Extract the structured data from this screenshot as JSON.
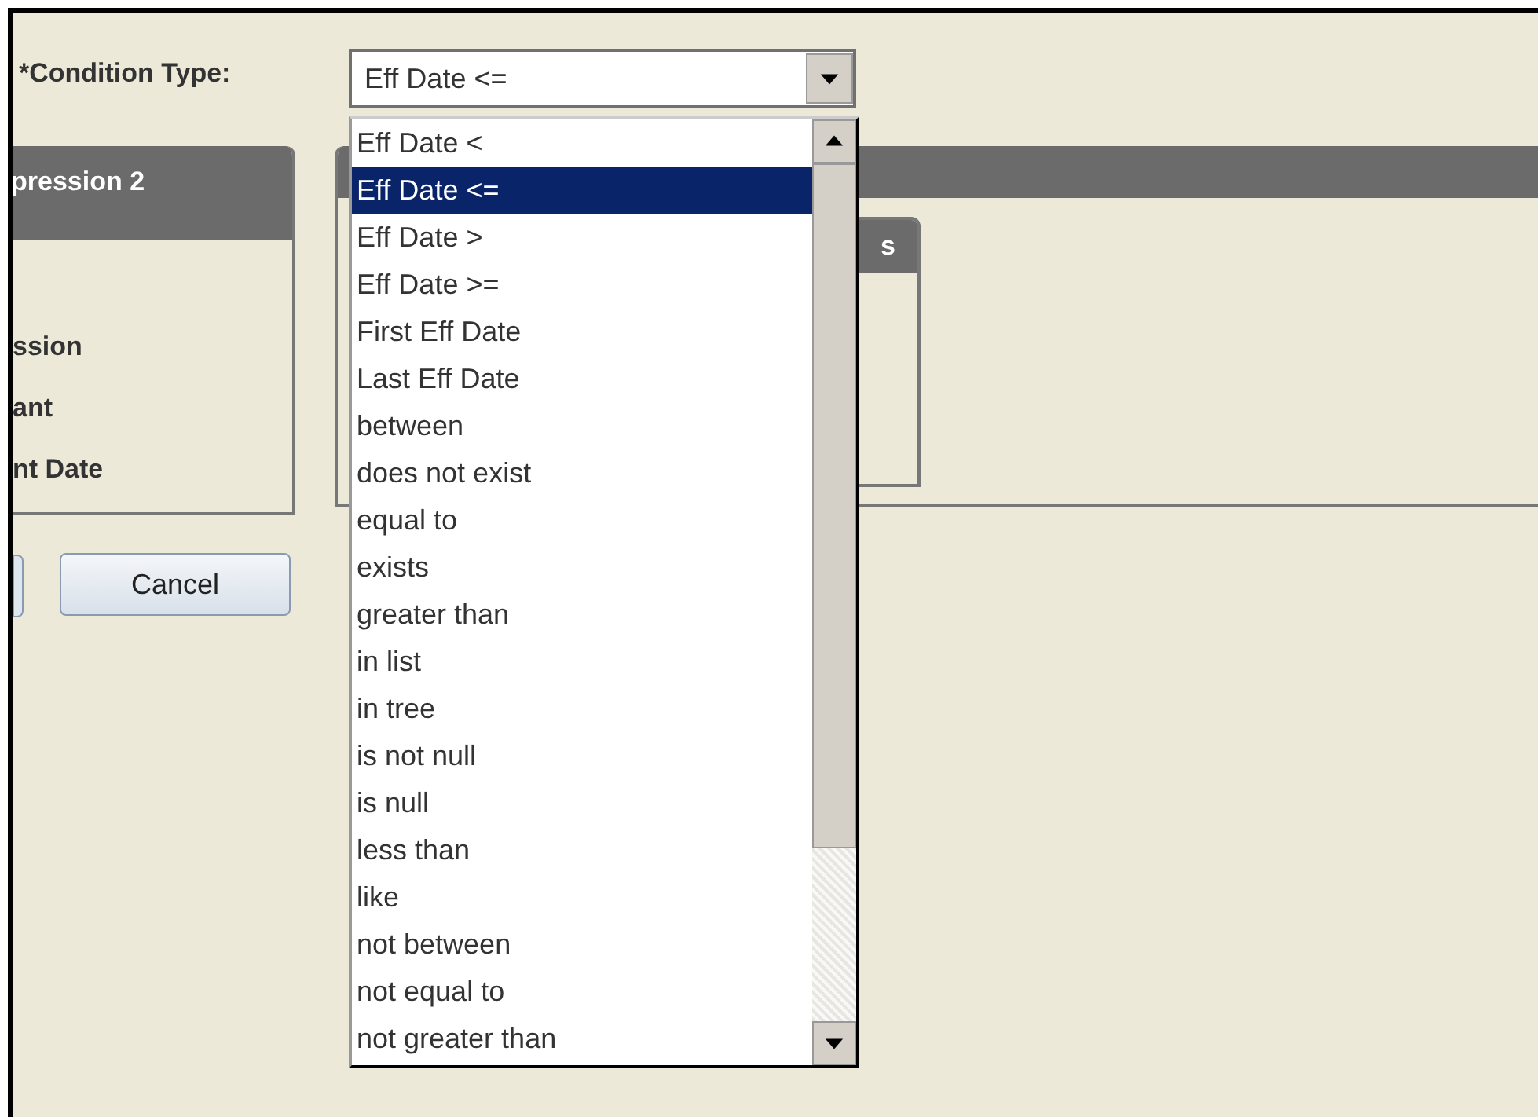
{
  "condition_type": {
    "label": "*Condition Type:",
    "value": "Eff Date <="
  },
  "dropdown": {
    "options": [
      {
        "label": "Eff Date <",
        "selected": false
      },
      {
        "label": "Eff Date <=",
        "selected": true
      },
      {
        "label": "Eff Date >",
        "selected": false
      },
      {
        "label": "Eff Date >=",
        "selected": false
      },
      {
        "label": "First Eff Date",
        "selected": false
      },
      {
        "label": "Last Eff Date",
        "selected": false
      },
      {
        "label": "between",
        "selected": false
      },
      {
        "label": "does not exist",
        "selected": false
      },
      {
        "label": "equal to",
        "selected": false
      },
      {
        "label": "exists",
        "selected": false
      },
      {
        "label": "greater than",
        "selected": false
      },
      {
        "label": "in list",
        "selected": false
      },
      {
        "label": "in tree",
        "selected": false
      },
      {
        "label": "is not null",
        "selected": false
      },
      {
        "label": "is null",
        "selected": false
      },
      {
        "label": "less than",
        "selected": false
      },
      {
        "label": "like",
        "selected": false
      },
      {
        "label": "not between",
        "selected": false
      },
      {
        "label": "not equal to",
        "selected": false
      },
      {
        "label": "not greater than",
        "selected": false
      }
    ]
  },
  "left_panel": {
    "title": "pression 2",
    "options": [
      "ssion",
      "ant",
      "nt Date"
    ]
  },
  "buttons": [
    "Cancel"
  ],
  "right_panel": {
    "subpanel_title": "s"
  }
}
